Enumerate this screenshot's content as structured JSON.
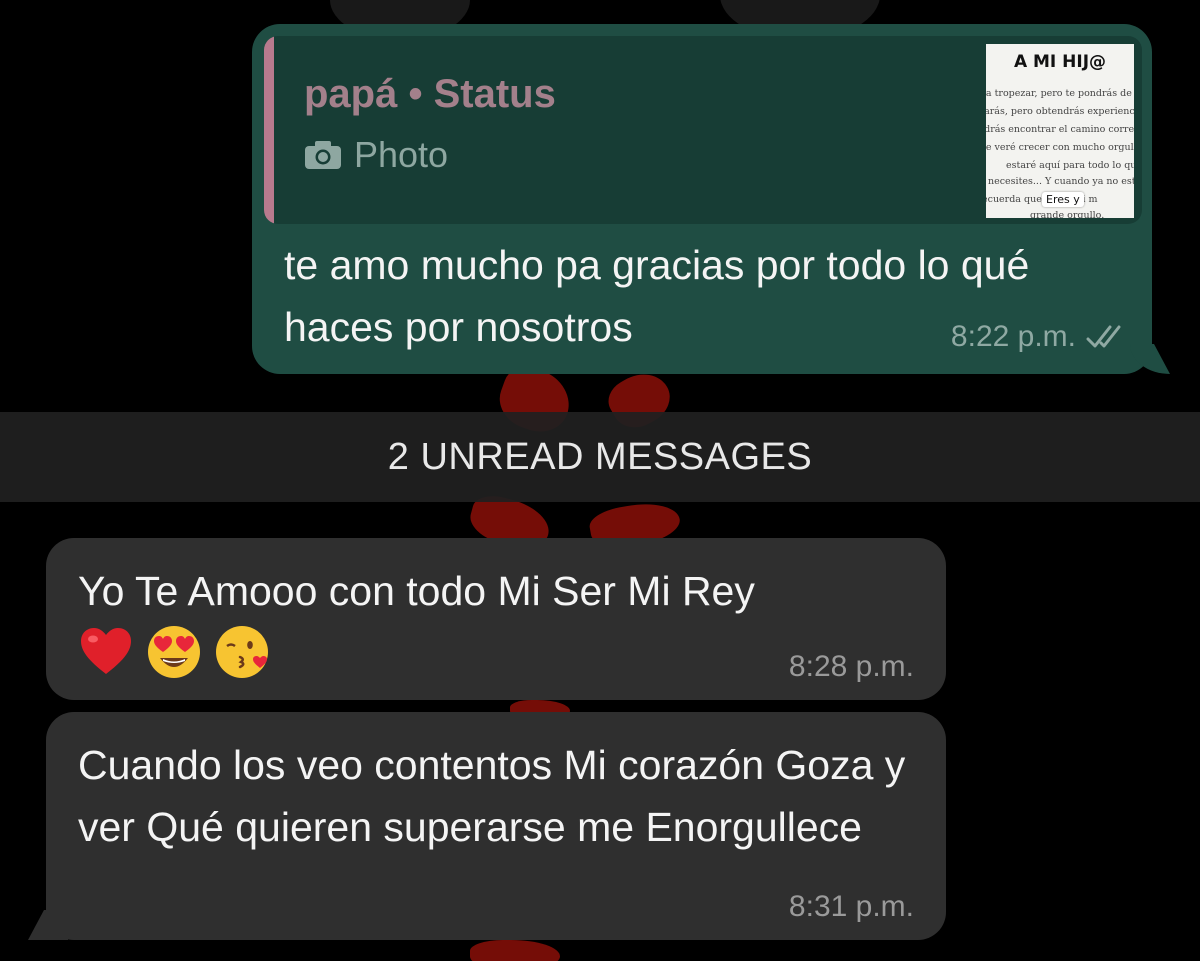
{
  "quoted_status": {
    "author": "papá • Status",
    "media_label": "Photo",
    "thumbnail": {
      "title": "A MI HIJ@",
      "lines": [
        "s a tropezar, pero te pondrás de p",
        "llarás, pero obtendrás experienci",
        "ndrás encontrar el camino correc",
        "te veré crecer con mucho orgullo",
        "estaré aquí para todo lo que",
        "necesites... Y cuando ya no este,",
        "ecuerda que        serás mi m",
        "grande orgullo."
      ],
      "chip": "Eres y"
    }
  },
  "outgoing_message": {
    "text": "te amo mucho pa gracias por todo lo qué haces por nosotros",
    "time": "8:22 p.m.",
    "status_icon": "double-check-icon"
  },
  "unread_banner": "2 UNREAD MESSAGES",
  "incoming_messages": [
    {
      "text": "Yo Te Amooo con todo Mi Ser  Mi Rey",
      "emojis": [
        "red-heart-icon",
        "heart-eyes-face-icon",
        "kissing-face-icon"
      ],
      "time": "8:28 p.m."
    },
    {
      "text": "Cuando los veo contentos Mi corazón Goza y ver Qué quieren superarse me Enorgullece",
      "time": "8:31 p.m."
    }
  ],
  "colors": {
    "background": "#000000",
    "outgoing_bubble": "#1f4d43",
    "incoming_bubble": "#2f2f2f",
    "quote_accent": "#b87a8e",
    "wallpaper_accent": "#8a0f08"
  }
}
